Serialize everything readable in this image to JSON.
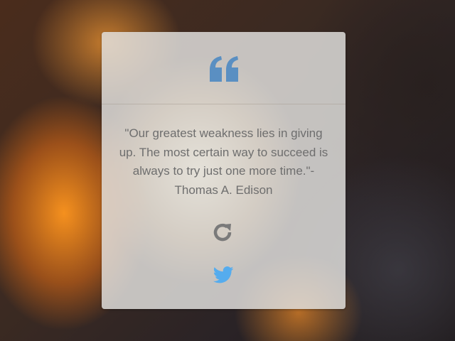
{
  "background": {
    "description_icon": "fire-background-image"
  },
  "card": {
    "header_icon": "quote-left-icon",
    "quote": "\"Our greatest weakness lies in giving up. The most certain way to succeed is always to try just one more time.\"- Thomas A. Edison",
    "refresh_icon": "refresh-icon",
    "tweet_icon": "twitter-icon"
  },
  "colors": {
    "quote_icon": "#5a8fc2",
    "refresh_icon": "#7a7a7a",
    "twitter_icon": "#55acee",
    "quote_text": "#6e6e6e",
    "card_bg": "#e1e0de"
  }
}
